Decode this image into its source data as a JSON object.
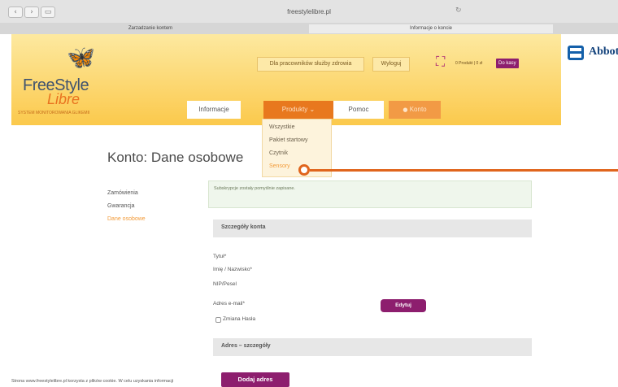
{
  "browser": {
    "back_icon": "chevron-left-icon",
    "forward_icon": "chevron-right-icon",
    "sidebar_icon": "sidebar-icon",
    "url": "freestylelibre.pl",
    "tabs": [
      {
        "label": "Zarzadzanie kontem"
      },
      {
        "label": "Informacje o koncie"
      }
    ]
  },
  "header": {
    "logo": {
      "free": "FreeStyle",
      "libre": "Libre",
      "tagline": "SYSTEM MONITOROWANIA GLIKEMII"
    },
    "links": {
      "professionals": "Dla pracowników służby zdrowia",
      "logout": "Wyloguj"
    },
    "cart": {
      "icon": "shopping-basket-icon",
      "count": "0 Produkt | 0 zł",
      "checkout": "Do kasy"
    },
    "abbott": "Abbott",
    "menu": {
      "info": "Informacje",
      "products": "Produkty",
      "help": "Pomoc",
      "account": "Konto"
    },
    "products_dropdown": [
      "Wszystkie",
      "Pakiet startowy",
      "Czytnik",
      "Sensory"
    ]
  },
  "main": {
    "title": "Konto: Dane osobowe",
    "sidebar": [
      "Zamówienia",
      "Gwarancja",
      "Dane osobowe"
    ],
    "notice": "Subskrypcje zostały pomyślnie zapisane.",
    "account_section": "Szczegóły konta",
    "fields": {
      "title": "Tytuł*",
      "name": "Imię / Nazwisko*",
      "nip": "NIP/Pesel",
      "email": "Adres e-mail*"
    },
    "edit_button": "Edytuj",
    "change_password": "Zmiana Hasła",
    "address_section": "Adres – szczegóły",
    "add_address_button": "Dodaj adres",
    "cookie_text": "Strona www.freestylelibre.pl korzysta z plików cookie. W celu uzyskania informacji"
  },
  "colors": {
    "background": "#f5d642",
    "accent_orange": "#e8781e",
    "brand_purple": "#8d1e6e",
    "abbott_blue": "#1460aa"
  }
}
